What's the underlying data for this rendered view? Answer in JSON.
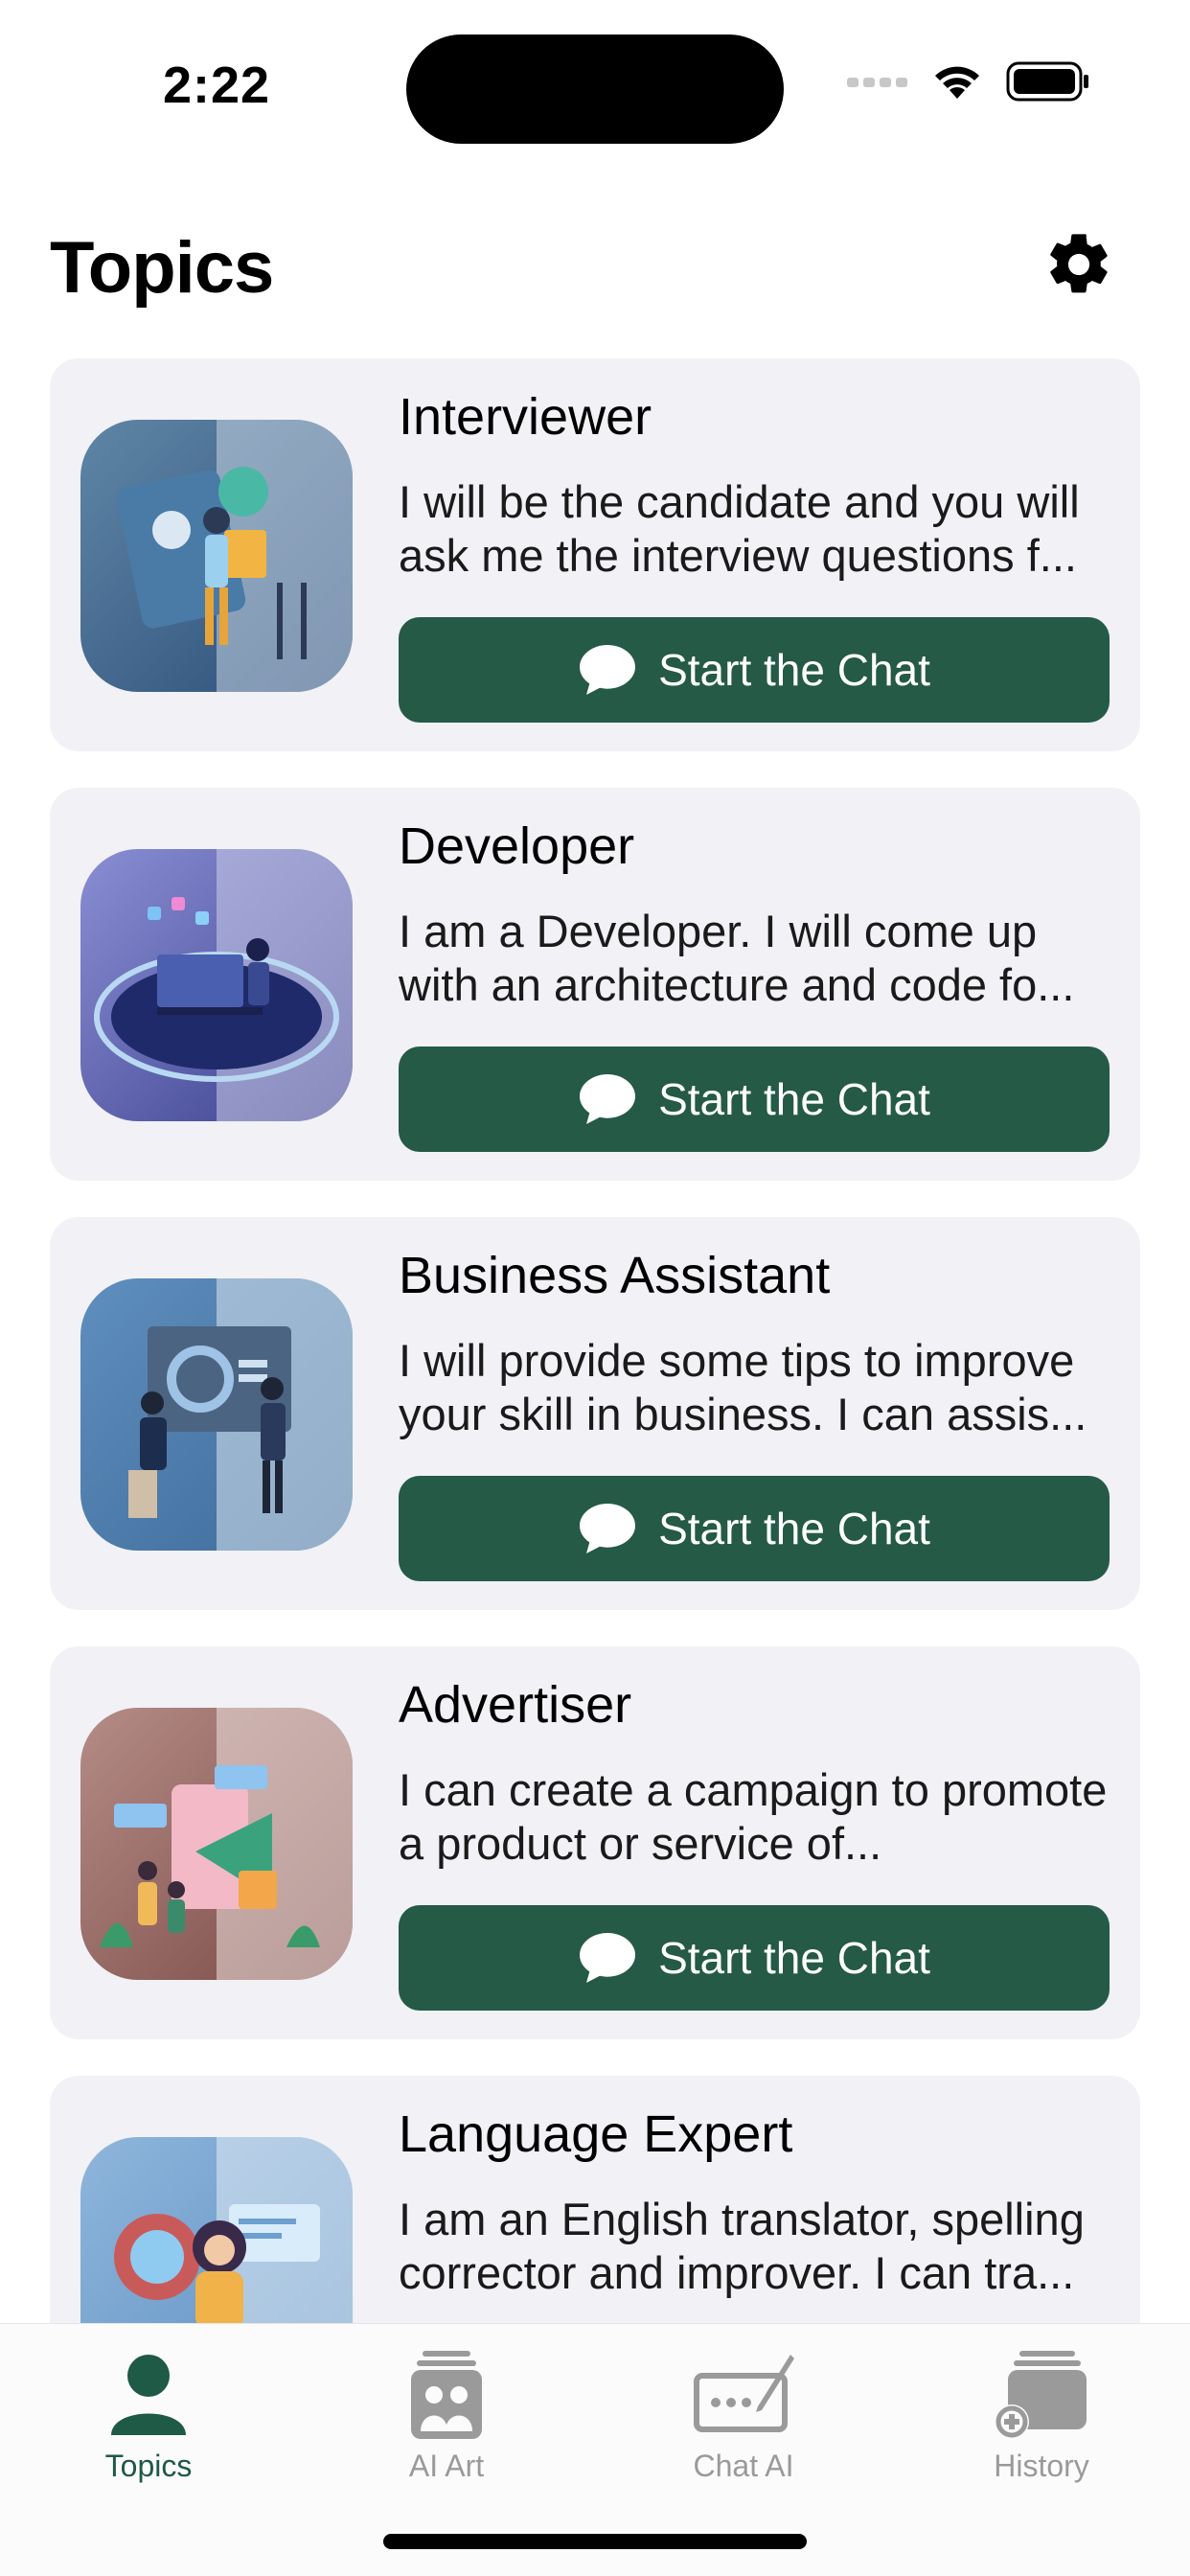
{
  "status_bar": {
    "time": "2:22"
  },
  "header": {
    "title": "Topics"
  },
  "topics": [
    {
      "title": "Interviewer",
      "description": "I will be the candidate and you will ask me the interview questions f...",
      "button_label": "Start the Chat"
    },
    {
      "title": "Developer",
      "description": "I am a Developer. I will come up with an architecture and code fo...",
      "button_label": "Start the Chat"
    },
    {
      "title": "Business Assistant",
      "description": "I will provide some tips to improve your skill in business. I can assis...",
      "button_label": "Start the Chat"
    },
    {
      "title": "Advertiser",
      "description": "I can create a campaign to promote a product or service of...",
      "button_label": "Start the Chat"
    },
    {
      "title": "Language Expert",
      "description": "I am an English translator, spelling corrector and improver. I can tra..."
    }
  ],
  "tab_bar": {
    "tabs": [
      {
        "label": "Topics",
        "icon": "person-icon",
        "active": true
      },
      {
        "label": "AI Art",
        "icon": "ai-art-icon",
        "active": false
      },
      {
        "label": "Chat AI",
        "icon": "chat-ai-icon",
        "active": false
      },
      {
        "label": "History",
        "icon": "history-icon",
        "active": false
      }
    ]
  },
  "colors": {
    "accent": "#245a46",
    "card_background": "#f1f1f6",
    "tab_inactive": "#9a9a9a"
  }
}
